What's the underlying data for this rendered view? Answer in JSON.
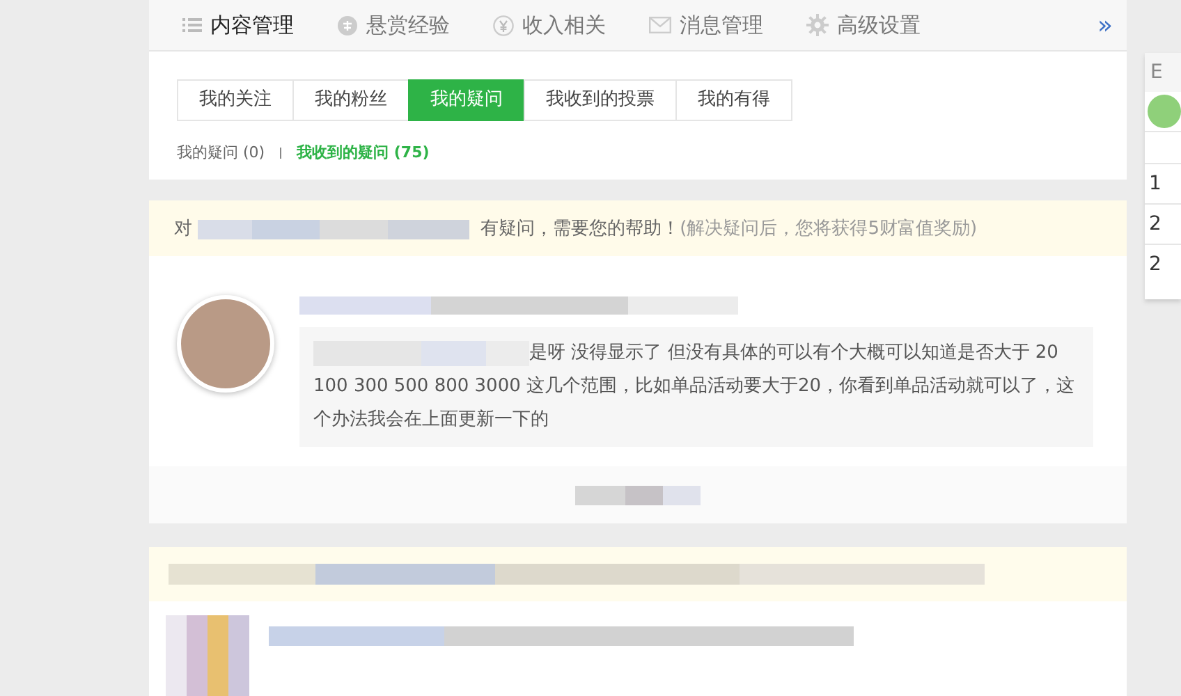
{
  "nav": {
    "items": [
      {
        "label": "内容管理",
        "kind": "list",
        "selected": true
      },
      {
        "label": "悬赏经验",
        "kind": "reward",
        "selected": false
      },
      {
        "label": "收入相关",
        "kind": "yen",
        "selected": false
      },
      {
        "label": "消息管理",
        "kind": "mail",
        "selected": false
      },
      {
        "label": "高级设置",
        "kind": "gear",
        "selected": false
      }
    ],
    "more": "»"
  },
  "tabs": [
    {
      "label": "我的关注",
      "selected": false
    },
    {
      "label": "我的粉丝",
      "selected": false
    },
    {
      "label": "我的疑问",
      "selected": true
    },
    {
      "label": "我收到的投票",
      "selected": false
    },
    {
      "label": "我的有得",
      "selected": false
    }
  ],
  "sub_tabs": [
    {
      "label": "我的疑问 (0)",
      "selected": false
    },
    {
      "label": "我收到的疑问 (75)",
      "selected": true
    }
  ],
  "questions": [
    {
      "notice_prefix": "对",
      "notice_text": "有疑问，需要您的帮助！",
      "notice_hint": "(解决疑问后，您将获得5财富值奖励)",
      "comment": "是呀 没得显示了 但没有具体的可以有个大概可以知道是否大于 20 100 300 500 800 3000 这几个范围，比如单品活动要大于20，你看到单品活动就可以了，这个办法我会在上面更新一下的"
    }
  ],
  "side_table": {
    "header": "E",
    "rows": [
      "1",
      "2",
      "2"
    ]
  }
}
